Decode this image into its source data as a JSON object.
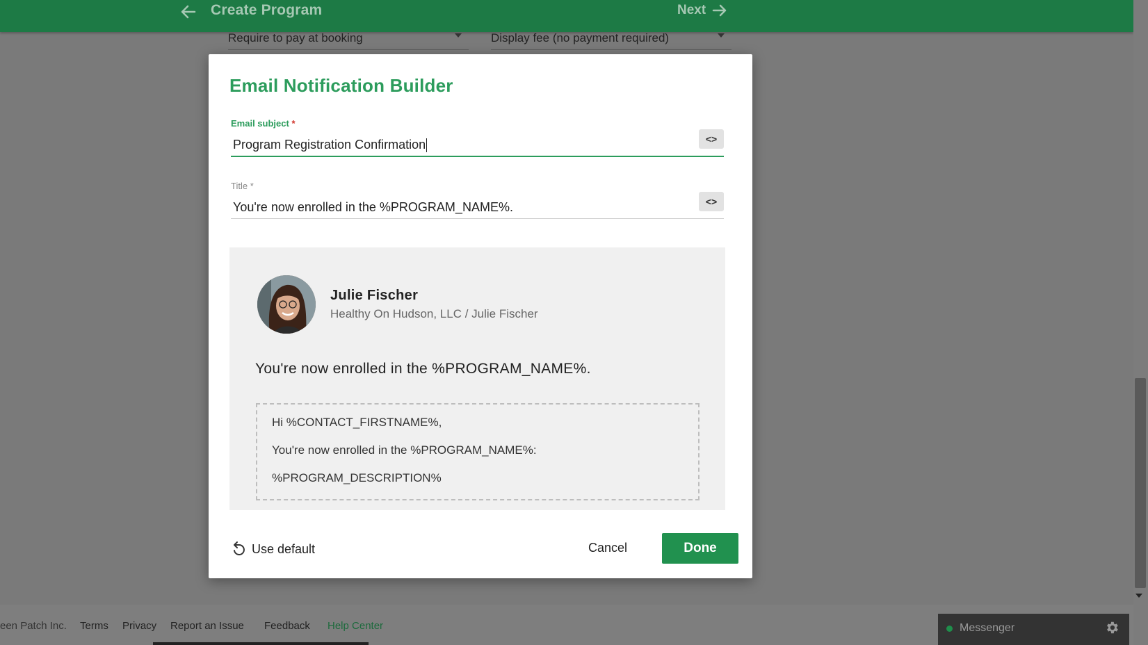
{
  "header": {
    "title": "Create Program",
    "next_label": "Next"
  },
  "background_form": {
    "payment_select": "Require to pay at booking",
    "fee_select": "Display fee (no payment required)"
  },
  "dialog": {
    "title": "Email Notification Builder",
    "subject": {
      "label": "Email subject",
      "required_mark": "*",
      "value": "Program Registration Confirmation",
      "code_button": "<>"
    },
    "title_field": {
      "label": "Title",
      "required_mark": "*",
      "value": "You're now enrolled in the %PROGRAM_NAME%.",
      "code_button": "<>"
    },
    "preview": {
      "sender_name": "Julie Fischer",
      "sender_org": "Healthy On Hudson, LLC / Julie Fischer",
      "heading": "You're now enrolled in the %PROGRAM_NAME%.",
      "body_lines": [
        "Hi %CONTACT_FIRSTNAME%,",
        "You're now enrolled in the %PROGRAM_NAME%:",
        "%PROGRAM_DESCRIPTION%"
      ]
    },
    "actions": {
      "use_default": "Use default",
      "cancel": "Cancel",
      "done": "Done"
    }
  },
  "footer": {
    "copyright": "een Patch Inc.",
    "links": [
      "Terms",
      "Privacy",
      "Report an Issue",
      "Feedback",
      "Help Center"
    ]
  },
  "messenger": {
    "label": "Messenger"
  },
  "colors": {
    "brand_green": "#21914f",
    "header_green": "#1d7a45",
    "accent_green": "#2c9c5c",
    "required_red": "#d0352b"
  },
  "icons": [
    "back-arrow-icon",
    "next-arrow-icon",
    "code-icon",
    "undo-icon",
    "gear-icon",
    "status-dot-icon"
  ]
}
